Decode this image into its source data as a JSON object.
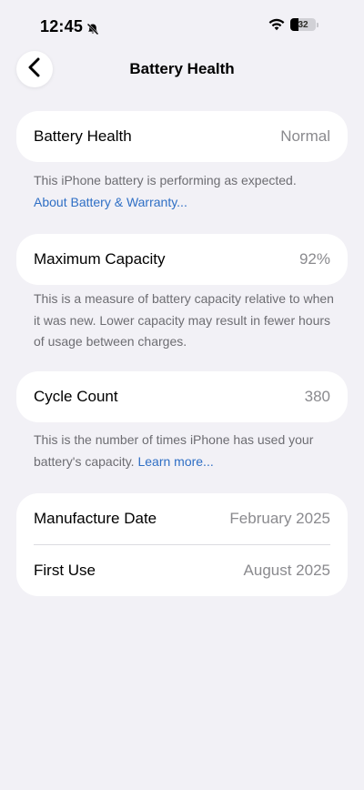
{
  "status_bar": {
    "time": "12:45",
    "battery_level": "32",
    "battery_fraction": 0.32,
    "icons": [
      "bell-slash-icon",
      "wifi-icon",
      "battery-icon"
    ]
  },
  "header": {
    "title": "Battery Health",
    "back_icon": "chevron-left-icon"
  },
  "battery_health": {
    "label": "Battery Health",
    "value": "Normal",
    "note": "This iPhone battery is performing as expected.",
    "link": "About Battery & Warranty..."
  },
  "maximum_capacity": {
    "label": "Maximum Capacity",
    "value": "92%",
    "note": "This is a measure of battery capacity relative to when it was new. Lower capacity may result in fewer hours of usage between charges."
  },
  "cycle_count": {
    "label": "Cycle Count",
    "value": "380",
    "note": "This is the number of times iPhone has used your battery's capacity.",
    "link": "Learn more..."
  },
  "dates": {
    "manufacture_label": "Manufacture Date",
    "manufacture_value": "February 2025",
    "first_use_label": "First Use",
    "first_use_value": "August 2025"
  },
  "colors": {
    "background": "#f2f1f6",
    "card": "#ffffff",
    "secondary_text": "#8a8a8e",
    "link": "#2f6fc5"
  }
}
